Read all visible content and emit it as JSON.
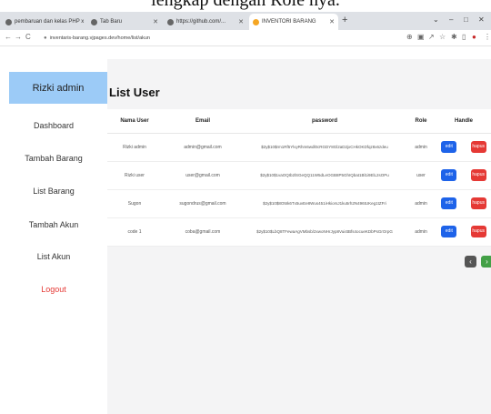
{
  "caption": "lengkap dengan Role nya.",
  "browser": {
    "tabs": [
      {
        "label": "pembaruan dan kelas PHP x"
      },
      {
        "label": "Tab Baru"
      },
      {
        "label": "https://github.com/..."
      },
      {
        "label": "INVENTORI BARANG"
      }
    ],
    "new_tab": "+",
    "url": "inventaris-barang.vjpages.dev/home/list/akun",
    "window_controls": {
      "minimize": "–",
      "maximize": "□",
      "close": "✕",
      "dropdown": "⌄"
    }
  },
  "sidebar": {
    "header": "Rizki admin",
    "items": [
      {
        "label": "Dashboard"
      },
      {
        "label": "Tambah Barang"
      },
      {
        "label": "List Barang"
      },
      {
        "label": "Tambah Akun"
      },
      {
        "label": "List Akun"
      }
    ],
    "logout": "Logout"
  },
  "main": {
    "title": "List User",
    "table": {
      "headers": [
        "Nama User",
        "Email",
        "password",
        "Role",
        "Handle"
      ],
      "rows": [
        {
          "name": "Rizki admin",
          "email": "admin@gmail.com",
          "password": "$2y$10$rm1Rf5YlvyRhm6wdl0cRGDY8Gl2aD2jxCHkOKDfqz8x6zdeu",
          "role": "admin"
        },
        {
          "name": "Rizki user",
          "email": "user@gmail.com",
          "password": "$2y$10$1vaOQIb2lSGeQQ11W5dLeOGB8P5GhIQbat1Bl1i9ElL2sOPu",
          "role": "user"
        },
        {
          "name": "Sugon",
          "email": "sugondrus@gmail.com",
          "password": "$2y$10$8O5Ik6Tx5uvEe8Wus451iHkiorsJ1ku5rh2N496tUKeg1tZFri",
          "role": "admin"
        },
        {
          "name": "code 1",
          "email": "coba@gmail.com",
          "password": "$2y$10$LbQ8TFewaAgVMbsb/2xwoNHrJyp8Vui4tBfs4ocueKDbPsGrOrpG",
          "role": "admin"
        }
      ],
      "edit_label": "edit",
      "hapus_label": "hapus"
    },
    "pager": {
      "prev": "‹",
      "next": "›"
    }
  },
  "colors": {
    "sidebar_header": "#9ccbf7",
    "edit": "#1e63e9",
    "hapus": "#e53935",
    "logout": "#e53935",
    "next": "#43a047"
  }
}
